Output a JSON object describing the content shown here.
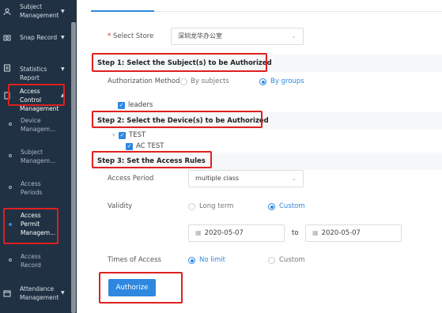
{
  "sidebar": {
    "items": [
      {
        "label": "Subject Management",
        "icon": "user-icon"
      },
      {
        "label": "Snap Record",
        "icon": "camera-icon"
      },
      {
        "label": "Statistics Report",
        "icon": "report-icon"
      },
      {
        "label": "Access Control Management",
        "icon": "door-icon"
      },
      {
        "label": "Attendance Management",
        "icon": "calendar-icon"
      }
    ],
    "subitems": [
      {
        "label": "Device Managem..."
      },
      {
        "label": "Subject Managem..."
      },
      {
        "label": "Access Periods"
      },
      {
        "label": "Access Permit Managem..."
      },
      {
        "label": "Access Record"
      }
    ]
  },
  "form": {
    "store_label": "Select Store",
    "store_required": "*",
    "store_value": "深圳龙华办公室",
    "step1_title": "Step 1: Select the Subject(s) to be Authorized",
    "auth_method_label": "Authorization Method",
    "by_subjects": "By subjects",
    "by_groups": "By groups",
    "group_item": "leaders",
    "step2_title": "Step 2: Select the Device(s) to be Authorized",
    "device_group": "TEST",
    "device_item": "AC TEST",
    "step3_title": "Step 3: Set the Access Rules",
    "access_period_label": "Access Period",
    "access_period_value": "multiple class",
    "validity_label": "Validity",
    "long_term": "Long term",
    "custom": "Custom",
    "start_date": "2020-05-07",
    "to_label": "to",
    "end_date": "2020-05-07",
    "times_label": "Times of Access",
    "no_limit": "No limit",
    "times_custom": "Custom",
    "authorize_button": "Authorize"
  },
  "colors": {
    "sidebar_bg": "#1f3143",
    "accent": "#2f88e0",
    "highlight": "#e02020"
  }
}
